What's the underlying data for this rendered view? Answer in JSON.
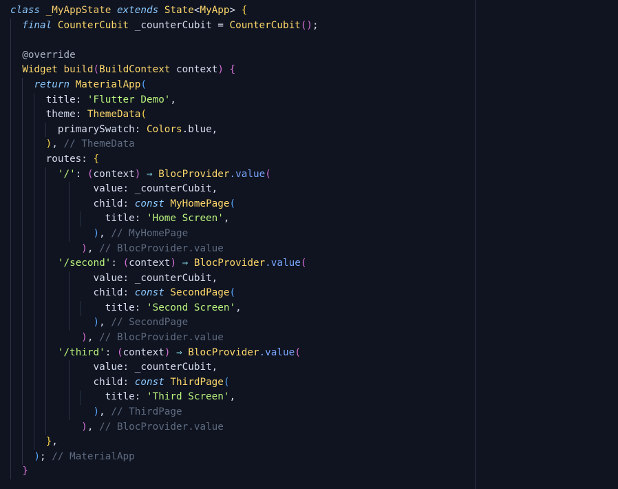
{
  "editor": {
    "lines": [
      [
        [
          "kw",
          "class"
        ],
        [
          "id",
          " "
        ],
        [
          "cls",
          "_MyAppState"
        ],
        [
          "id",
          " "
        ],
        [
          "kw",
          "extends"
        ],
        [
          "id",
          " "
        ],
        [
          "ty",
          "State"
        ],
        [
          "punc",
          "<"
        ],
        [
          "ty",
          "MyApp"
        ],
        [
          "punc",
          ">"
        ],
        [
          "id",
          " "
        ],
        [
          "pb1",
          "{"
        ]
      ],
      [
        [
          "id",
          "  "
        ],
        [
          "kw",
          "final"
        ],
        [
          "id",
          " "
        ],
        [
          "ty",
          "CounterCubit"
        ],
        [
          "id",
          " _counterCubit "
        ],
        [
          "punc",
          "="
        ],
        [
          "id",
          " "
        ],
        [
          "ty",
          "CounterCubit"
        ],
        [
          "pb2",
          "()"
        ],
        [
          "punc",
          ";"
        ]
      ],
      [],
      [
        [
          "id",
          "  "
        ],
        [
          "ann",
          "@override"
        ]
      ],
      [
        [
          "id",
          "  "
        ],
        [
          "ty",
          "Widget"
        ],
        [
          "id",
          " "
        ],
        [
          "cls",
          "build"
        ],
        [
          "pb2",
          "("
        ],
        [
          "ty",
          "BuildContext"
        ],
        [
          "id",
          " context"
        ],
        [
          "pb2",
          ")"
        ],
        [
          "id",
          " "
        ],
        [
          "pb2",
          "{"
        ]
      ],
      [
        [
          "id",
          "    "
        ],
        [
          "kw",
          "return"
        ],
        [
          "id",
          " "
        ],
        [
          "ty",
          "MaterialApp"
        ],
        [
          "pb3",
          "("
        ]
      ],
      [
        [
          "id",
          "      title: "
        ],
        [
          "str",
          "'Flutter Demo'"
        ],
        [
          "punc",
          ","
        ]
      ],
      [
        [
          "id",
          "      theme: "
        ],
        [
          "ty",
          "ThemeData"
        ],
        [
          "pb1",
          "("
        ]
      ],
      [
        [
          "id",
          "        primarySwatch: "
        ],
        [
          "ty",
          "Colors"
        ],
        [
          "id",
          ".blue,"
        ]
      ],
      [
        [
          "id",
          "      "
        ],
        [
          "pb1",
          ")"
        ],
        [
          "punc",
          ","
        ],
        [
          "id",
          " "
        ],
        [
          "cmt",
          "// ThemeData"
        ]
      ],
      [
        [
          "id",
          "      routes: "
        ],
        [
          "pb1",
          "{"
        ]
      ],
      [
        [
          "id",
          "        "
        ],
        [
          "str",
          "'/'"
        ],
        [
          "punc",
          ":"
        ],
        [
          "id",
          " "
        ],
        [
          "pb2",
          "("
        ],
        [
          "id",
          "context"
        ],
        [
          "pb2",
          ")"
        ],
        [
          "id",
          " "
        ],
        [
          "op",
          "⇒"
        ],
        [
          "id",
          " "
        ],
        [
          "ty",
          "BlocProvider"
        ],
        [
          "fn",
          ".value"
        ],
        [
          "pb2",
          "("
        ]
      ],
      [
        [
          "id",
          "              value: _counterCubit,"
        ]
      ],
      [
        [
          "id",
          "              child: "
        ],
        [
          "kw",
          "const"
        ],
        [
          "id",
          " "
        ],
        [
          "ty",
          "MyHomePage"
        ],
        [
          "pb3",
          "("
        ]
      ],
      [
        [
          "id",
          "                title: "
        ],
        [
          "str",
          "'Home Screen'"
        ],
        [
          "punc",
          ","
        ]
      ],
      [
        [
          "id",
          "              "
        ],
        [
          "pb3",
          ")"
        ],
        [
          "punc",
          ","
        ],
        [
          "id",
          " "
        ],
        [
          "cmt",
          "// MyHomePage"
        ]
      ],
      [
        [
          "id",
          "            "
        ],
        [
          "pb2",
          ")"
        ],
        [
          "punc",
          ","
        ],
        [
          "id",
          " "
        ],
        [
          "cmt",
          "// BlocProvider.value"
        ]
      ],
      [
        [
          "id",
          "        "
        ],
        [
          "str",
          "'/second'"
        ],
        [
          "punc",
          ":"
        ],
        [
          "id",
          " "
        ],
        [
          "pb2",
          "("
        ],
        [
          "id",
          "context"
        ],
        [
          "pb2",
          ")"
        ],
        [
          "id",
          " "
        ],
        [
          "op",
          "⇒"
        ],
        [
          "id",
          " "
        ],
        [
          "ty",
          "BlocProvider"
        ],
        [
          "fn",
          ".value"
        ],
        [
          "pb2",
          "("
        ]
      ],
      [
        [
          "id",
          "              value: _counterCubit,"
        ]
      ],
      [
        [
          "id",
          "              child: "
        ],
        [
          "kw",
          "const"
        ],
        [
          "id",
          " "
        ],
        [
          "ty",
          "SecondPage"
        ],
        [
          "pb3",
          "("
        ]
      ],
      [
        [
          "id",
          "                title: "
        ],
        [
          "str",
          "'Second Screen'"
        ],
        [
          "punc",
          ","
        ]
      ],
      [
        [
          "id",
          "              "
        ],
        [
          "pb3",
          ")"
        ],
        [
          "punc",
          ","
        ],
        [
          "id",
          " "
        ],
        [
          "cmt",
          "// SecondPage"
        ]
      ],
      [
        [
          "id",
          "            "
        ],
        [
          "pb2",
          ")"
        ],
        [
          "punc",
          ","
        ],
        [
          "id",
          " "
        ],
        [
          "cmt",
          "// BlocProvider.value"
        ]
      ],
      [
        [
          "id",
          "        "
        ],
        [
          "str",
          "'/third'"
        ],
        [
          "punc",
          ":"
        ],
        [
          "id",
          " "
        ],
        [
          "pb2",
          "("
        ],
        [
          "id",
          "context"
        ],
        [
          "pb2",
          ")"
        ],
        [
          "id",
          " "
        ],
        [
          "op",
          "⇒"
        ],
        [
          "id",
          " "
        ],
        [
          "ty",
          "BlocProvider"
        ],
        [
          "fn",
          ".value"
        ],
        [
          "pb2",
          "("
        ]
      ],
      [
        [
          "id",
          "              value: _counterCubit,"
        ]
      ],
      [
        [
          "id",
          "              child: "
        ],
        [
          "kw",
          "const"
        ],
        [
          "id",
          " "
        ],
        [
          "ty",
          "ThirdPage"
        ],
        [
          "pb3",
          "("
        ]
      ],
      [
        [
          "id",
          "                title: "
        ],
        [
          "str",
          "'Third Screen'"
        ],
        [
          "punc",
          ","
        ]
      ],
      [
        [
          "id",
          "              "
        ],
        [
          "pb3",
          ")"
        ],
        [
          "punc",
          ","
        ],
        [
          "id",
          " "
        ],
        [
          "cmt",
          "// ThirdPage"
        ]
      ],
      [
        [
          "id",
          "            "
        ],
        [
          "pb2",
          ")"
        ],
        [
          "punc",
          ","
        ],
        [
          "id",
          " "
        ],
        [
          "cmt",
          "// BlocProvider.value"
        ]
      ],
      [
        [
          "id",
          "      "
        ],
        [
          "pb1",
          "}"
        ],
        [
          "punc",
          ","
        ]
      ],
      [
        [
          "id",
          "    "
        ],
        [
          "pb3",
          ")"
        ],
        [
          "punc",
          ";"
        ],
        [
          "id",
          " "
        ],
        [
          "cmt",
          "// MaterialApp"
        ]
      ],
      [
        [
          "id",
          "  "
        ],
        [
          "pb2",
          "}"
        ]
      ]
    ]
  }
}
